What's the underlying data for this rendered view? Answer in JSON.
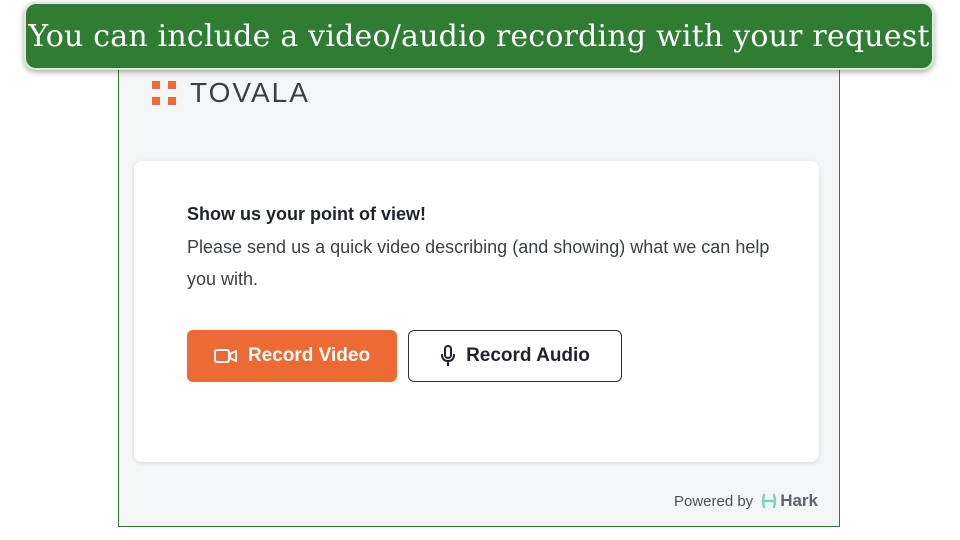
{
  "banner": {
    "text": "You can include a video/audio recording with your request"
  },
  "brand": {
    "name": "TOVALA",
    "accent_color": "#ee6a34"
  },
  "card": {
    "heading": "Show us your point of view!",
    "description": "Please send us a quick video describing (and showing) what we can help you with."
  },
  "buttons": {
    "record_video": {
      "label": "Record Video",
      "icon": "video-camera-icon"
    },
    "record_audio": {
      "label": "Record Audio",
      "icon": "microphone-icon"
    }
  },
  "footer": {
    "powered_by": "Powered by",
    "provider": "Hark",
    "provider_icon": "hark-logo-icon"
  },
  "colors": {
    "banner_bg": "#2e7d32",
    "primary_button": "#ee6a34",
    "panel_bg": "#f4f5f7"
  }
}
